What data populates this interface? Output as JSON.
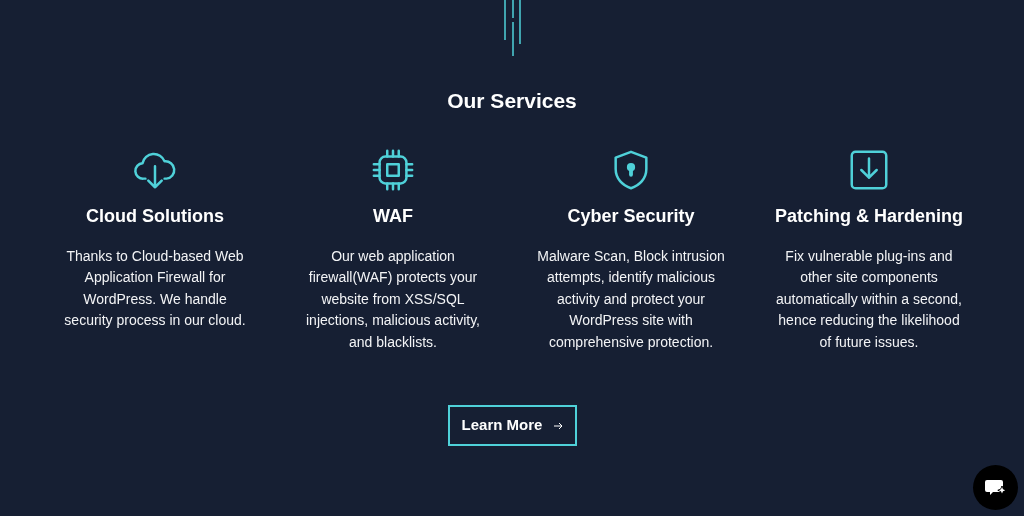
{
  "title": "Our Services",
  "services": [
    {
      "kind": "cloud",
      "name": "Cloud Solutions",
      "lines": [
        "Thanks to Cloud-based Web",
        "Application Firewall for",
        "WordPress. We handle",
        "security process in our cloud."
      ]
    },
    {
      "kind": "chip",
      "name": "WAF",
      "lines": [
        "Our web application",
        "firewall(WAF) protects your",
        "website from XSS/SQL",
        "injections, malicious activity,",
        "and blacklists."
      ]
    },
    {
      "kind": "shield",
      "name": "Cyber Security",
      "lines": [
        "Malware Scan, Block intrusion",
        "attempts, identify malicious",
        "activity and protect your",
        "WordPress site with",
        "comprehensive protection."
      ]
    },
    {
      "kind": "download",
      "name": "Patching & Hardening",
      "lines": [
        "Fix vulnerable plug-ins and",
        "other site components",
        "automatically within a second,",
        "hence reducing the likelihood",
        "of future issues."
      ]
    }
  ],
  "button": {
    "label": "Learn More"
  }
}
